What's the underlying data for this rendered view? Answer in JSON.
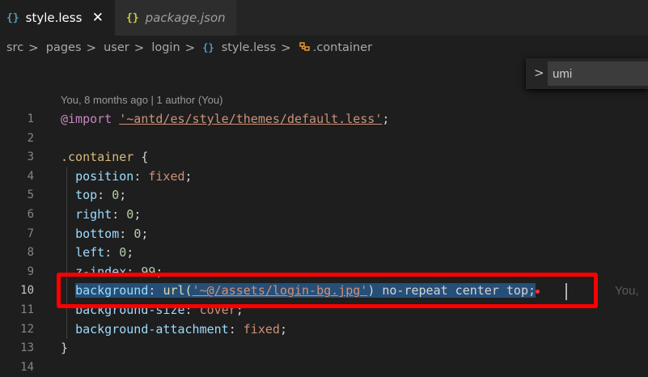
{
  "tabs": [
    {
      "icon": "{}",
      "label": "style.less",
      "active": true,
      "close": "✕"
    },
    {
      "icon": "{}",
      "label": "package.json",
      "active": false
    }
  ],
  "breadcrumb": {
    "items": [
      "src",
      "pages",
      "user",
      "login"
    ],
    "file_icon": "{}",
    "file": "style.less",
    "symbol": ".container",
    "separator": ">"
  },
  "find": {
    "toggle": ">",
    "value": "umi"
  },
  "codelens": "You, 8 months ago | 1 author (You)",
  "lines": {
    "n1": "1",
    "n2": "2",
    "n3": "3",
    "n4": "4",
    "n5": "5",
    "n6": "6",
    "n7": "7",
    "n8": "8",
    "n9": "9",
    "n10": "10",
    "n11": "11",
    "n12": "12",
    "n13": "13",
    "n14": "14"
  },
  "code": {
    "l1_kw": "@import",
    "l1_str": "'~antd/es/style/themes/default.less'",
    "l1_end": ";",
    "l3_sel": ".container",
    "l3_brace": " {",
    "l4_prop": "position",
    "l4_val": "fixed",
    "l5_prop": "top",
    "l5_val": "0",
    "l6_prop": "right",
    "l6_val": "0",
    "l7_prop": "bottom",
    "l7_val": "0",
    "l8_prop": "left",
    "l8_val": "0",
    "l9_prop": "z-index",
    "l9_val": "99",
    "l10_prop": "background",
    "l10_fn": "url(",
    "l10_str": "'~@/assets/login-bg.jpg'",
    "l10_rest": ") no-repeat center top",
    "l10_end": ";",
    "l11_prop": "background-size",
    "l11_val": "cover",
    "l12_prop": "background-attachment",
    "l12_val": "fixed",
    "l13": "}",
    "colon": ": ",
    "semi": ";"
  },
  "blame_inline": "You,"
}
